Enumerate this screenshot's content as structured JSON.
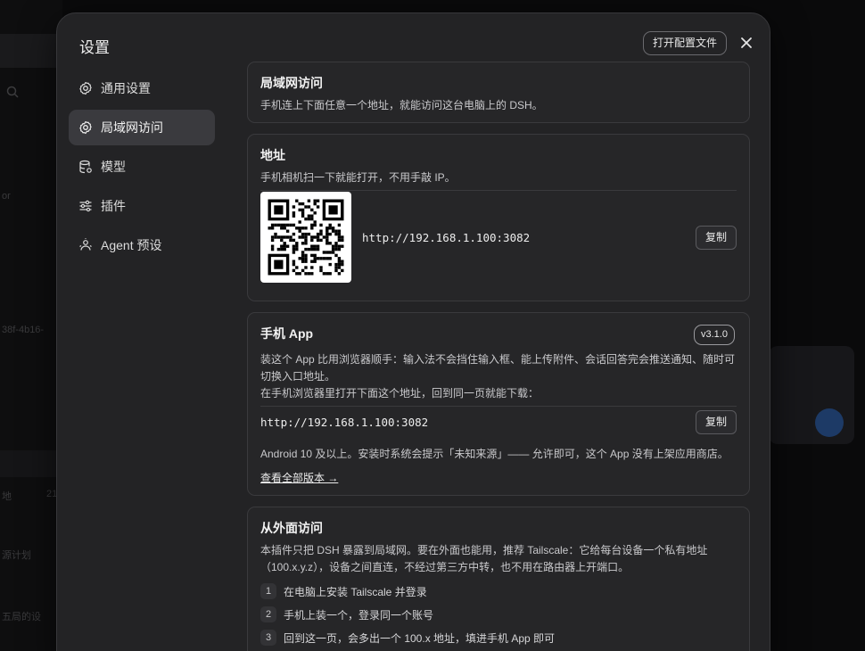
{
  "background": {
    "faint_texts": [
      "or",
      "38f-4b16-",
      "地",
      "21",
      "源计划",
      "五局的设"
    ]
  },
  "modal": {
    "title": "设置",
    "open_config_label": "打开配置文件"
  },
  "sidebar": {
    "items": [
      {
        "label": "通用设置",
        "icon": "gear-icon"
      },
      {
        "label": "局域网访问",
        "icon": "gear-icon"
      },
      {
        "label": "模型",
        "icon": "database-icon"
      },
      {
        "label": "插件",
        "icon": "sliders-icon"
      },
      {
        "label": "Agent 预设",
        "icon": "agent-icon"
      }
    ],
    "active_index": 1
  },
  "lan_card": {
    "title": "局域网访问",
    "desc": "手机连上下面任意一个地址，就能访问这台电脑上的 DSH。"
  },
  "address_card": {
    "title": "地址",
    "desc": "手机相机扫一下就能打开，不用手敲 IP。",
    "url": "http://192.168.1.100:3082",
    "copy_label": "复制"
  },
  "app_card": {
    "title": "手机 App",
    "version": "v3.1.0",
    "desc1": "装这个 App 比用浏览器顺手：输入法不会挡住输入框、能上传附件、会话回答完会推送通知、随时可切换入口地址。",
    "desc2": "在手机浏览器里打开下面这个地址，回到同一页就能下载：",
    "url": "http://192.168.1.100:3082",
    "copy_label": "复制",
    "note": "Android 10 及以上。安装时系统会提示「未知来源」—— 允许即可，这个 App 没有上架应用商店。",
    "all_versions_link": "查看全部版本 →"
  },
  "remote_card": {
    "title": "从外面访问",
    "desc": "本插件只把 DSH 暴露到局域网。要在外面也能用，推荐 Tailscale：它给每台设备一个私有地址（100.x.y.z），设备之间直连，不经过第三方中转，也不用在路由器上开端口。",
    "steps": [
      {
        "num": "1",
        "text": "在电脑上安装 Tailscale 并登录"
      },
      {
        "num": "2",
        "text": "手机上装一个，登录同一个账号"
      },
      {
        "num": "3",
        "text": "回到这一页，会多出一个 100.x 地址，填进手机 App 即可"
      }
    ]
  }
}
